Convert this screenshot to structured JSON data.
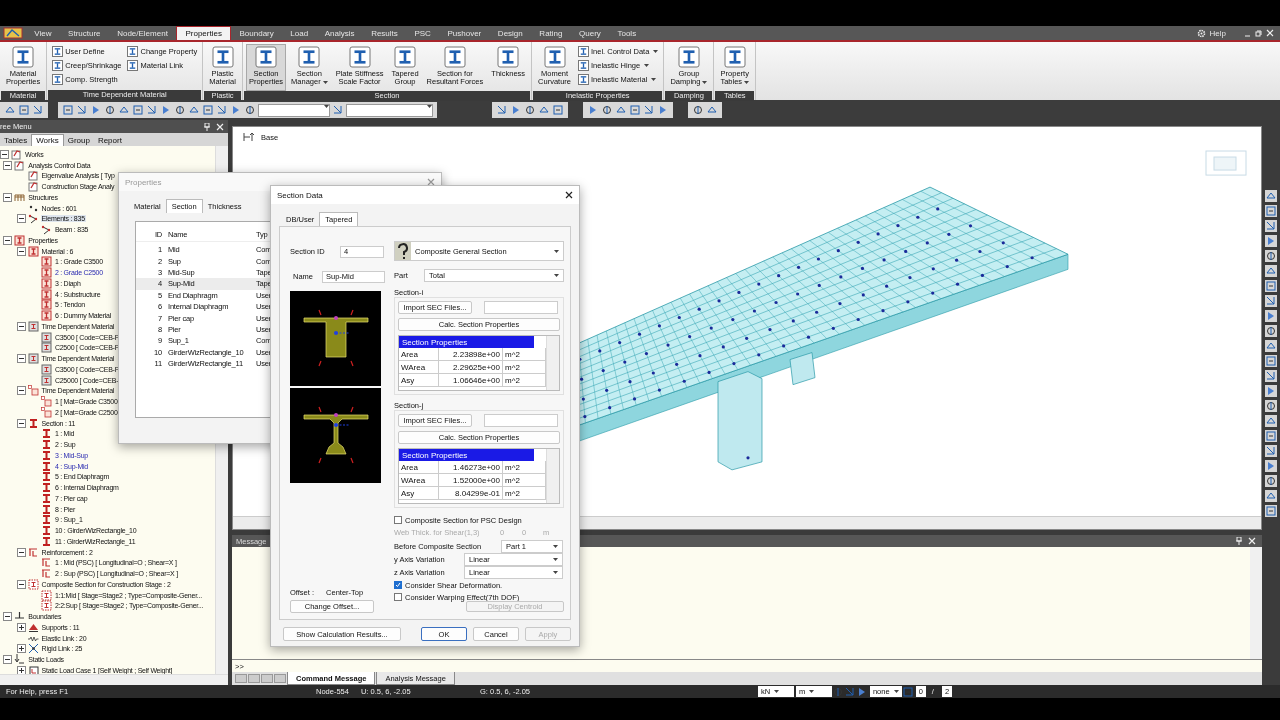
{
  "menu_tabs": [
    {
      "label": "View",
      "selected": false
    },
    {
      "label": "Structure",
      "selected": false
    },
    {
      "label": "Node/Element",
      "selected": false
    },
    {
      "label": "Properties",
      "selected": true
    },
    {
      "label": "Boundary",
      "selected": false
    },
    {
      "label": "Load",
      "selected": false
    },
    {
      "label": "Analysis",
      "selected": false
    },
    {
      "label": "Results",
      "selected": false
    },
    {
      "label": "PSC",
      "selected": false
    },
    {
      "label": "Pushover",
      "selected": false
    },
    {
      "label": "Design",
      "selected": false
    },
    {
      "label": "Rating",
      "selected": false
    },
    {
      "label": "Query",
      "selected": false
    },
    {
      "label": "Tools",
      "selected": false
    }
  ],
  "help_label": "Help",
  "ribbon_groups": [
    {
      "title": "Material",
      "items": [
        {
          "kind": "large",
          "lines": [
            "Material",
            "Properties"
          ],
          "dropdown": false,
          "selected": false
        }
      ]
    },
    {
      "title": "Time Dependent Material",
      "items": [
        {
          "kind": "small",
          "label": "User Define",
          "dropdown": false
        },
        {
          "kind": "small",
          "label": "Creep/Shrinkage",
          "dropdown": false
        },
        {
          "kind": "small",
          "label": "Comp. Strength",
          "dropdown": false
        },
        {
          "kind": "small",
          "label": "Change Property",
          "dropdown": false
        },
        {
          "kind": "small",
          "label": "Material Link",
          "dropdown": false
        }
      ]
    },
    {
      "title": "Plastic",
      "items": [
        {
          "kind": "large",
          "lines": [
            "Plastic",
            "Material"
          ],
          "dropdown": false,
          "selected": false
        }
      ]
    },
    {
      "title": "Section",
      "items": [
        {
          "kind": "large",
          "lines": [
            "Section",
            "Properties"
          ],
          "dropdown": false,
          "selected": true
        },
        {
          "kind": "large",
          "lines": [
            "Section",
            "Manager"
          ],
          "dropdown": true,
          "selected": false
        },
        {
          "kind": "large",
          "lines": [
            "Plate Stiffness",
            "Scale Factor"
          ],
          "dropdown": false,
          "selected": false
        },
        {
          "kind": "large",
          "lines": [
            "Tapered",
            "Group"
          ],
          "dropdown": false,
          "selected": false
        },
        {
          "kind": "large",
          "lines": [
            "Section for",
            "Resultant Forces"
          ],
          "dropdown": false,
          "selected": false
        },
        {
          "kind": "large",
          "lines": [
            "Thickness"
          ],
          "dropdown": false,
          "selected": false
        }
      ]
    },
    {
      "title": "Inelastic Properties",
      "items": [
        {
          "kind": "large",
          "lines": [
            "Moment",
            "Curvature"
          ],
          "dropdown": false,
          "selected": false
        },
        {
          "kind": "small",
          "label": "Inel. Control Data",
          "dropdown": true
        },
        {
          "kind": "small",
          "label": "Inelastic Hinge",
          "dropdown": true
        },
        {
          "kind": "small",
          "label": "Inelastic Material",
          "dropdown": true
        }
      ]
    },
    {
      "title": "Damping",
      "items": [
        {
          "kind": "large",
          "lines": [
            "Group",
            "Damping"
          ],
          "dropdown": true,
          "selected": false
        }
      ]
    },
    {
      "title": "Tables",
      "items": [
        {
          "kind": "large",
          "lines": [
            "Property",
            "Tables"
          ],
          "dropdown": true,
          "selected": false
        }
      ]
    }
  ],
  "tree_panel": {
    "title": "ree Menu",
    "tabs": [
      {
        "label": "Tables",
        "selected": false
      },
      {
        "label": "Works",
        "selected": true
      },
      {
        "label": "Group",
        "selected": false
      },
      {
        "label": "Report",
        "selected": false
      }
    ],
    "items": [
      {
        "label": "Works",
        "kind": "works",
        "expanded": true,
        "children": [
          {
            "label": "Analysis Control Data",
            "kind": "analysis",
            "expanded": true,
            "children": [
              {
                "label": "Eigenvalue Analysis [ Typ",
                "kind": "analysis"
              },
              {
                "label": "Construction Stage Analy",
                "kind": "analysis"
              }
            ]
          },
          {
            "label": "Structures",
            "kind": "structure",
            "expanded": true,
            "children": [
              {
                "label": "Nodes : 601",
                "kind": "node",
                "selected": false
              },
              {
                "label": "Elements : 835",
                "kind": "element",
                "selected": true,
                "expanded": true,
                "children": [
                  {
                    "label": "Beam : 835",
                    "kind": "element"
                  }
                ]
              }
            ]
          },
          {
            "label": "Properties",
            "kind": "material",
            "expanded": true,
            "children": [
              {
                "label": "Material : 6",
                "kind": "material",
                "expanded": true,
                "children": [
                  {
                    "label": "1 : Grade C3500",
                    "kind": "material",
                    "highlighted": false
                  },
                  {
                    "label": "2 : Grade C2500",
                    "kind": "material",
                    "highlighted": true
                  },
                  {
                    "label": "3 : Diaph",
                    "kind": "material",
                    "highlighted": false
                  },
                  {
                    "label": "4 : Substructure",
                    "kind": "material",
                    "highlighted": false
                  },
                  {
                    "label": "5 : Tendon",
                    "kind": "material",
                    "highlighted": false
                  },
                  {
                    "label": "6 : Dummy Material",
                    "kind": "material",
                    "highlighted": false
                  }
                ]
              },
              {
                "label": "Time Dependent Material",
                "kind": "time",
                "expanded": true,
                "children": [
                  {
                    "label": "C3500 [ Code=CEB-F",
                    "kind": "time"
                  },
                  {
                    "label": "C2500 [ Code=CEB-F",
                    "kind": "time"
                  }
                ]
              },
              {
                "label": "Time Dependent Material",
                "kind": "time",
                "expanded": true,
                "children": [
                  {
                    "label": "C3500 [ Code=CEB-F",
                    "kind": "time"
                  },
                  {
                    "label": "C25000 [ Code=CEB-",
                    "kind": "time"
                  }
                ]
              },
              {
                "label": "Time Dependent Material",
                "kind": "link",
                "expanded": true,
                "children": [
                  {
                    "label": "1 [ Mat=Grade C3500",
                    "kind": "link"
                  },
                  {
                    "label": "2 [ Mat=Grade C2500",
                    "kind": "link"
                  }
                ]
              },
              {
                "label": "Section : 11",
                "kind": "section",
                "expanded": true,
                "children": [
                  {
                    "label": "1 : Mid",
                    "kind": "section",
                    "highlighted": false
                  },
                  {
                    "label": "2 : Sup",
                    "kind": "section",
                    "highlighted": false
                  },
                  {
                    "label": "3 : Mid-Sup",
                    "kind": "section",
                    "highlighted": true
                  },
                  {
                    "label": "4 : Sup-Mid",
                    "kind": "section",
                    "highlighted": true
                  },
                  {
                    "label": "5 : End Diaphragm",
                    "kind": "section",
                    "highlighted": false
                  },
                  {
                    "label": "6 : Internal Diaphragm",
                    "kind": "section",
                    "highlighted": false
                  },
                  {
                    "label": "7 : Pier cap",
                    "kind": "section",
                    "highlighted": false
                  },
                  {
                    "label": "8 : Pier",
                    "kind": "section",
                    "highlighted": false
                  },
                  {
                    "label": "9 : Sup_1",
                    "kind": "section",
                    "highlighted": false
                  },
                  {
                    "label": "10 : GirderWizRectangle_10",
                    "kind": "section",
                    "highlighted": false
                  },
                  {
                    "label": "11 : GirderWizRectangle_11",
                    "kind": "section",
                    "highlighted": false
                  }
                ]
              },
              {
                "label": "Reinforcement : 2",
                "kind": "rebar",
                "expanded": true,
                "children": [
                  {
                    "label": "1 : Mid (PSC) [ Longitudinal=O ; Shear=X ]",
                    "kind": "rebar"
                  },
                  {
                    "label": "2 : Sup (PSC) [ Longitudinal=O ; Shear=X ]",
                    "kind": "rebar"
                  }
                ]
              },
              {
                "label": "Composite Section for Construction Stage : 2",
                "kind": "composite",
                "expanded": true,
                "children": [
                  {
                    "label": "1:1:Mid [ Stage=Stage2 ; Type=Composite-Gener...",
                    "kind": "composite"
                  },
                  {
                    "label": "2:2:Sup [ Stage=Stage2 ; Type=Composite-Gener...",
                    "kind": "composite"
                  }
                ]
              }
            ]
          },
          {
            "label": "Boundaries",
            "kind": "boundary",
            "expanded": true,
            "children": [
              {
                "label": "Supports : 11",
                "kind": "support",
                "expanded": false
              },
              {
                "label": "Elastic Link : 20",
                "kind": "spring"
              },
              {
                "label": "Rigid Link : 25",
                "kind": "rigid",
                "expanded": false
              }
            ]
          },
          {
            "label": "Static Loads",
            "kind": "load",
            "expanded": true,
            "children": [
              {
                "label": "Static Load Case 1 [Self Weight ; Self Weight]",
                "kind": "loadcase",
                "expanded": false
              }
            ]
          }
        ]
      }
    ]
  },
  "viewport": {
    "view_label": "Base"
  },
  "message_window": {
    "title": "Message",
    "prompt": ">>",
    "tabs": [
      {
        "label": "Command Message",
        "selected": true
      },
      {
        "label": "Analysis Message",
        "selected": false
      }
    ]
  },
  "status_bar": {
    "help": "For Help, press F1",
    "node": "Node-554",
    "user_coords": "U: 0.5, 6, -2.05",
    "global_coords": "G: 0.5, 6, -2.05",
    "force_unit": "kN",
    "length_unit": "m",
    "option": "none",
    "value": "0",
    "separator": "/",
    "total": "2"
  },
  "properties_dialog": {
    "title": "Properties",
    "tabs": [
      {
        "label": "Material",
        "selected": false
      },
      {
        "label": "Section",
        "selected": true
      },
      {
        "label": "Thickness",
        "selected": false
      }
    ],
    "columns": [
      "ID",
      "Name",
      "Typ"
    ],
    "rows": [
      {
        "id": "1",
        "name": "Mid",
        "type": "Com",
        "selected": false
      },
      {
        "id": "2",
        "name": "Sup",
        "type": "Com",
        "selected": false
      },
      {
        "id": "3",
        "name": "Mid-Sup",
        "type": "Tape",
        "selected": false
      },
      {
        "id": "4",
        "name": "Sup-Mid",
        "type": "Tape",
        "selected": true
      },
      {
        "id": "5",
        "name": "End Diaphragm",
        "type": "User",
        "selected": false
      },
      {
        "id": "6",
        "name": "Internal Diaphragm",
        "type": "User",
        "selected": false
      },
      {
        "id": "7",
        "name": "Pier cap",
        "type": "User",
        "selected": false
      },
      {
        "id": "8",
        "name": "Pier",
        "type": "User",
        "selected": false
      },
      {
        "id": "9",
        "name": "Sup_1",
        "type": "Com",
        "selected": false
      },
      {
        "id": "10",
        "name": "GirderWizRectangle_10",
        "type": "User",
        "selected": false
      },
      {
        "id": "11",
        "name": "GirderWizRectangle_11",
        "type": "User",
        "selected": false
      }
    ]
  },
  "section_dialog": {
    "title": "Section Data",
    "tabs": [
      {
        "label": "DB/User",
        "selected": false
      },
      {
        "label": "Tapered",
        "selected": true
      }
    ],
    "section_id_label": "Section ID",
    "section_id": "4",
    "section_type": "Composite General Section",
    "name_label": "Name",
    "name": "Sup-Mid",
    "part_label": "Part",
    "part": "Total",
    "sections": [
      {
        "title": "Section-i",
        "import_button": "Import SEC Files...",
        "calc_button": "Calc. Section Properties",
        "table_title": "Section Properties",
        "rows": [
          {
            "name": "Area",
            "value": "2.23898e+00",
            "unit": "m^2"
          },
          {
            "name": "WArea",
            "value": "2.29625e+00",
            "unit": "m^2"
          },
          {
            "name": "Asy",
            "value": "1.06646e+00",
            "unit": "m^2"
          }
        ]
      },
      {
        "title": "Section-j",
        "import_button": "Import SEC Files...",
        "calc_button": "Calc. Section Properties",
        "table_title": "Section Properties",
        "rows": [
          {
            "name": "Area",
            "value": "1.46273e+00",
            "unit": "m^2"
          },
          {
            "name": "WArea",
            "value": "1.52000e+00",
            "unit": "m^2"
          },
          {
            "name": "Asy",
            "value": "8.04299e-01",
            "unit": "m^2"
          }
        ]
      }
    ],
    "composite_psc": {
      "label": "Composite Section for PSC Design",
      "checked": false
    },
    "web_thick": {
      "label": "Web Thick. for Shear(1,3)",
      "values": [
        "0",
        "0"
      ],
      "unit": "m",
      "disabled": true
    },
    "before_composite": {
      "label": "Before Composite Section",
      "value": "Part 1"
    },
    "variations": [
      {
        "label": "y Axis Variation",
        "value": "Linear"
      },
      {
        "label": "z Axis Variation",
        "value": "Linear"
      }
    ],
    "options": [
      {
        "label": "Consider Shear Deformation.",
        "checked": true
      },
      {
        "label": "Consider Warping Effect(7th DOF)",
        "checked": false
      }
    ],
    "display_centroid": {
      "label": "Display Centroid",
      "disabled": true
    },
    "offset_label": "Offset :",
    "offset": "Center-Top",
    "change_offset": "Change Offset...",
    "buttons": [
      {
        "label": "Show Calculation Results...",
        "disabled": false
      },
      {
        "label": "OK",
        "disabled": false
      },
      {
        "label": "Cancel",
        "disabled": false
      },
      {
        "label": "Apply",
        "disabled": true
      }
    ]
  }
}
